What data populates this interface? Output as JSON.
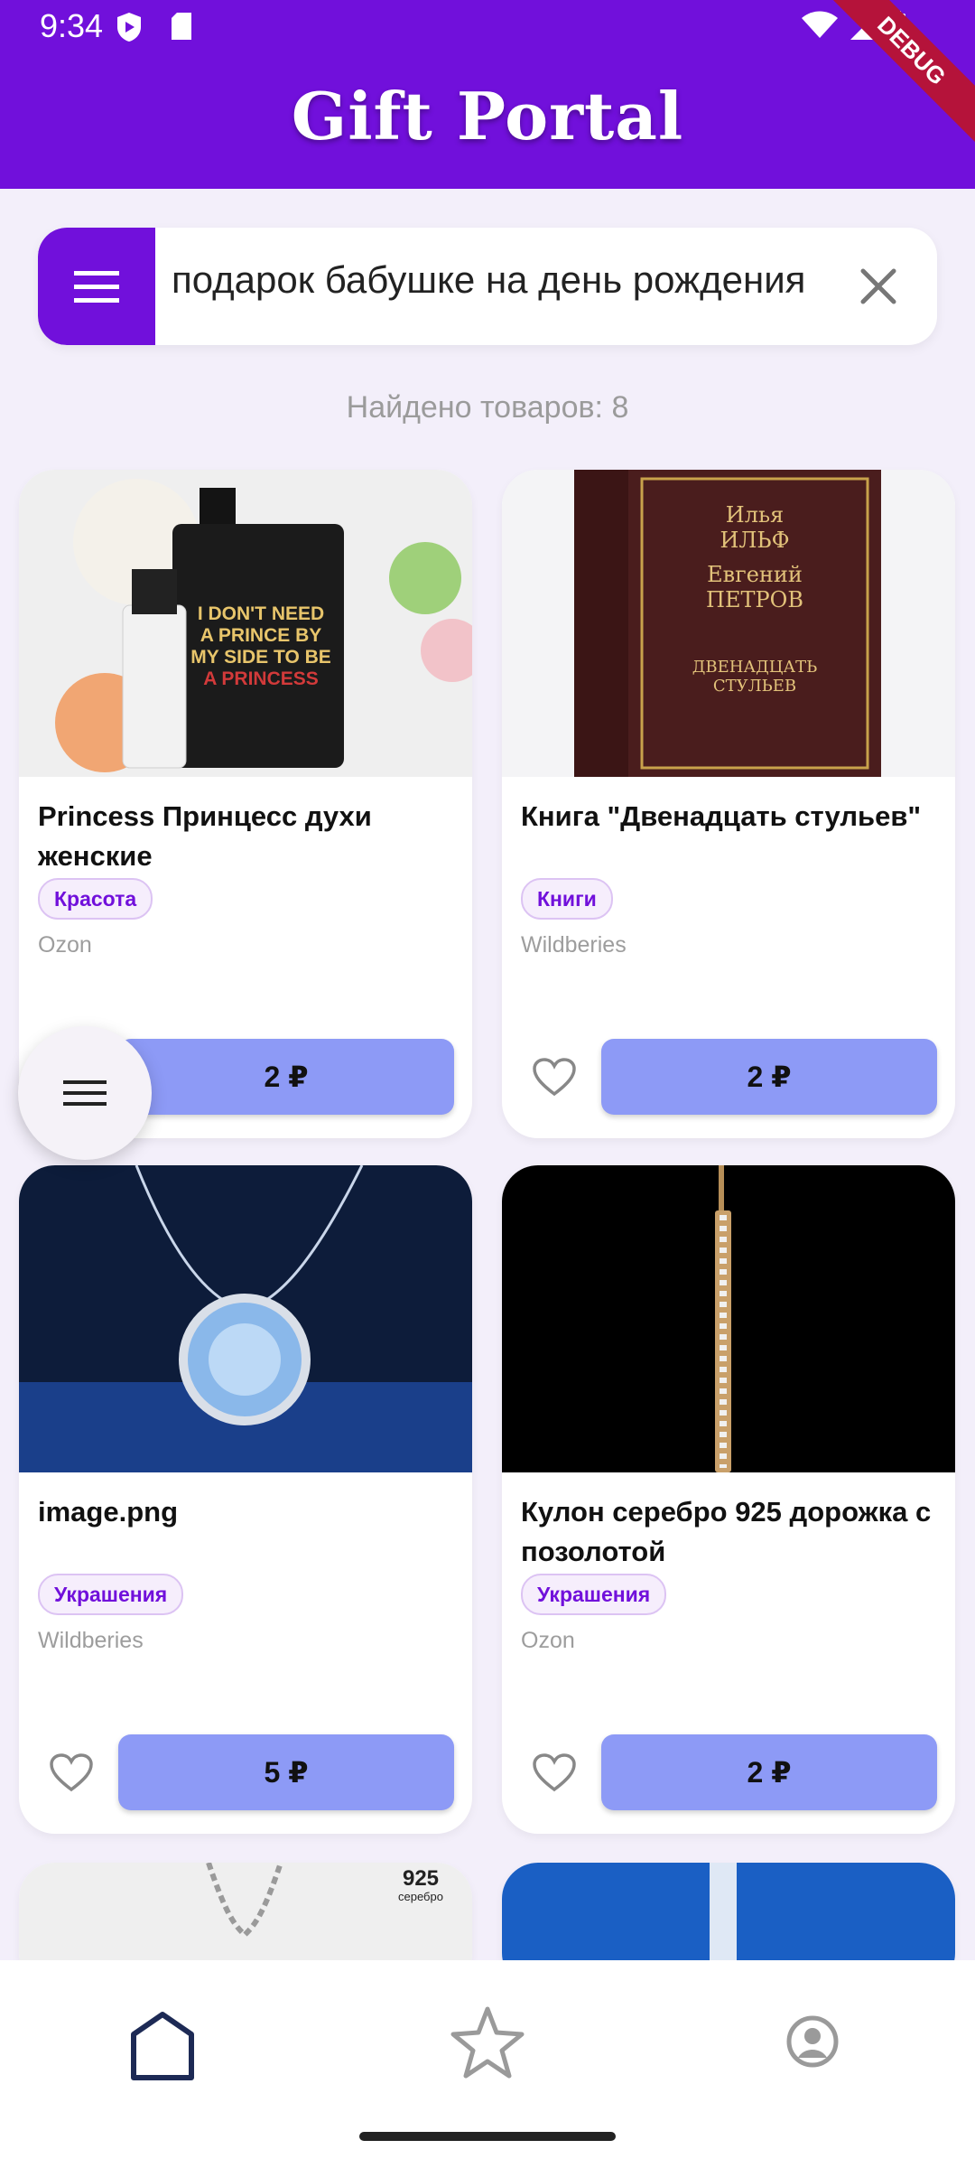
{
  "status_bar": {
    "time": "9:34"
  },
  "app": {
    "title": "Gift Portal",
    "debug_banner": "DEBUG"
  },
  "search": {
    "query": "подарок бабушке на день рождения"
  },
  "results": {
    "found_text": "Найдено товаров: 8"
  },
  "products": [
    {
      "name": "Princess Принцесс духи женские",
      "category": "Красота",
      "shop": "Ozon",
      "price": "2 ₽",
      "image": "perfume-image"
    },
    {
      "name": "Книга \"Двенадцать стульев\"",
      "category": "Книги",
      "shop": "Wildberies",
      "price": "2 ₽",
      "image": "book-image"
    },
    {
      "name": "image.png",
      "category": "Украшения",
      "shop": "Wildberies",
      "price": "5 ₽",
      "image": "pendant-image"
    },
    {
      "name": "Кулон серебро 925 дорожка с позолотой",
      "category": "Украшения",
      "shop": "Ozon",
      "price": "2 ₽",
      "image": "gold-bar-pendant-image"
    }
  ],
  "image_text": {
    "perfume_label": [
      "I DON'T NEED",
      "A PRINCE BY",
      "MY SIDE TO BE",
      "A PRINCESS"
    ],
    "book_cover": [
      "Илья",
      "ИЛЬФ",
      "Евгений",
      "ПЕТРОВ",
      "ДВЕНАДЦАТЬ",
      "СТУЛЬЕВ"
    ],
    "silver_label": [
      "925",
      "серебро"
    ]
  },
  "bottom_nav": [
    "home-icon",
    "star-icon",
    "profile-icon"
  ],
  "colors": {
    "primary": "#7110db",
    "price_button": "#8d9af6",
    "background": "#f3effa"
  }
}
